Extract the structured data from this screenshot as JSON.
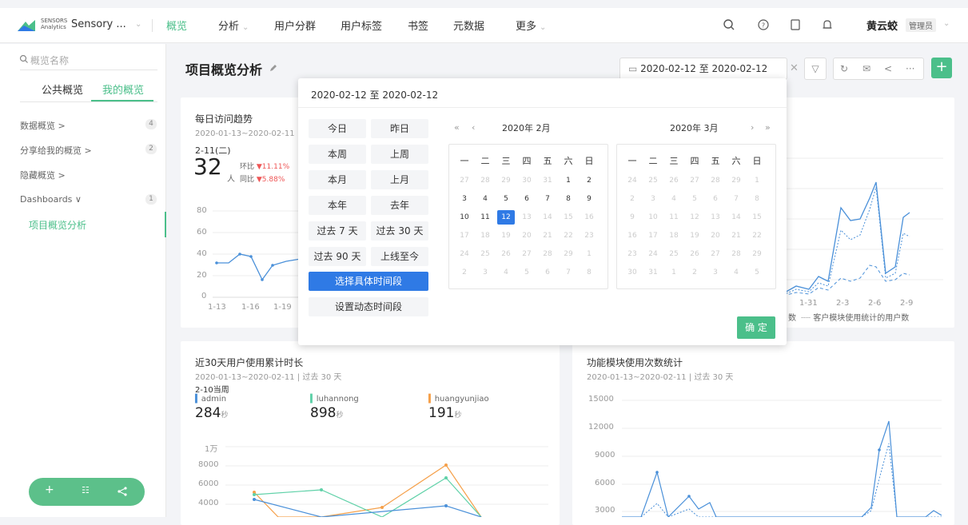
{
  "topbar": {
    "logo_top": "SENSORS",
    "logo_bottom": "Analytics",
    "project": "Sensory ...",
    "nav": [
      {
        "label": "概览",
        "active": true,
        "caret": ""
      },
      {
        "label": "分析",
        "active": false,
        "caret": "⌄"
      },
      {
        "label": "用户分群",
        "active": false,
        "caret": ""
      },
      {
        "label": "用户标签",
        "active": false,
        "caret": ""
      },
      {
        "label": "书签",
        "active": false,
        "caret": ""
      },
      {
        "label": "元数据",
        "active": false,
        "caret": ""
      },
      {
        "label": "更多",
        "active": false,
        "caret": "⌄"
      }
    ],
    "user_name": "黄云蛟",
    "user_role": "管理员"
  },
  "sidebar": {
    "search_placeholder": "概览名称",
    "tab_public": "公共概览",
    "tab_mine": "我的概览",
    "items": [
      {
        "label": "数据概览 >",
        "count": "4"
      },
      {
        "label": "分享给我的概览 >",
        "count": "2"
      },
      {
        "label": "隐藏概览 >",
        "count": ""
      },
      {
        "label": "Dashboards ∨",
        "count": "1"
      }
    ],
    "active_item": "项目概览分析"
  },
  "main": {
    "title": "项目概览分析",
    "date_range": "2020-02-12 至 2020-02-12"
  },
  "card1": {
    "title": "每日访问趋势",
    "sub": "2020-01-13~2020-02-11 | 过去",
    "date": "2-11(二)",
    "value": "32",
    "unit": "人",
    "cmp1_label": "环比",
    "cmp1_value": "▼11.11%",
    "cmp2_label": "同比",
    "cmp2_value": "▼5.88%",
    "yticks": [
      "80",
      "60",
      "40",
      "20",
      "0"
    ],
    "xticks": [
      "1-13",
      "1-16",
      "1-19"
    ]
  },
  "card2": {
    "xticks": [
      "1-31",
      "2-3",
      "2-6",
      "2-9"
    ],
    "legend_a": "数",
    "legend_b": "客户模块使用统计的用户数"
  },
  "card3": {
    "title": "近30天用户使用累计时长",
    "sub": "2020-01-13~2020-02-11 | 过去 30 天",
    "week": "2-10当周",
    "users": [
      {
        "name": "admin",
        "value": "284",
        "unit": "秒",
        "color": "#4a90d9"
      },
      {
        "name": "luhannong",
        "value": "898",
        "unit": "秒",
        "color": "#5fd1a8"
      },
      {
        "name": "huangyunjiao",
        "value": "191",
        "unit": "秒",
        "color": "#f5a04a"
      }
    ],
    "yticks": [
      "1万",
      "8000",
      "6000",
      "4000"
    ]
  },
  "card4": {
    "title": "功能模块使用次数统计",
    "sub": "2020-01-13~2020-02-11 | 过去 30 天",
    "yticks": [
      "15000",
      "12000",
      "9000",
      "6000",
      "3000"
    ]
  },
  "popup": {
    "header": "2020-02-12 至 2020-02-12",
    "presets": [
      "今日",
      "昨日",
      "本周",
      "上周",
      "本月",
      "上月",
      "本年",
      "去年",
      "过去 7 天",
      "过去 30 天",
      "过去 90 天",
      "上线至今"
    ],
    "select_range": "选择具体时间段",
    "dynamic_range": "设置动态时间段",
    "left_month": {
      "year": "2020年",
      "month": "2月"
    },
    "right_month": {
      "year": "2020年",
      "month": "3月"
    },
    "weekdays": [
      "一",
      "二",
      "三",
      "四",
      "五",
      "六",
      "日"
    ],
    "confirm": "确 定"
  }
}
